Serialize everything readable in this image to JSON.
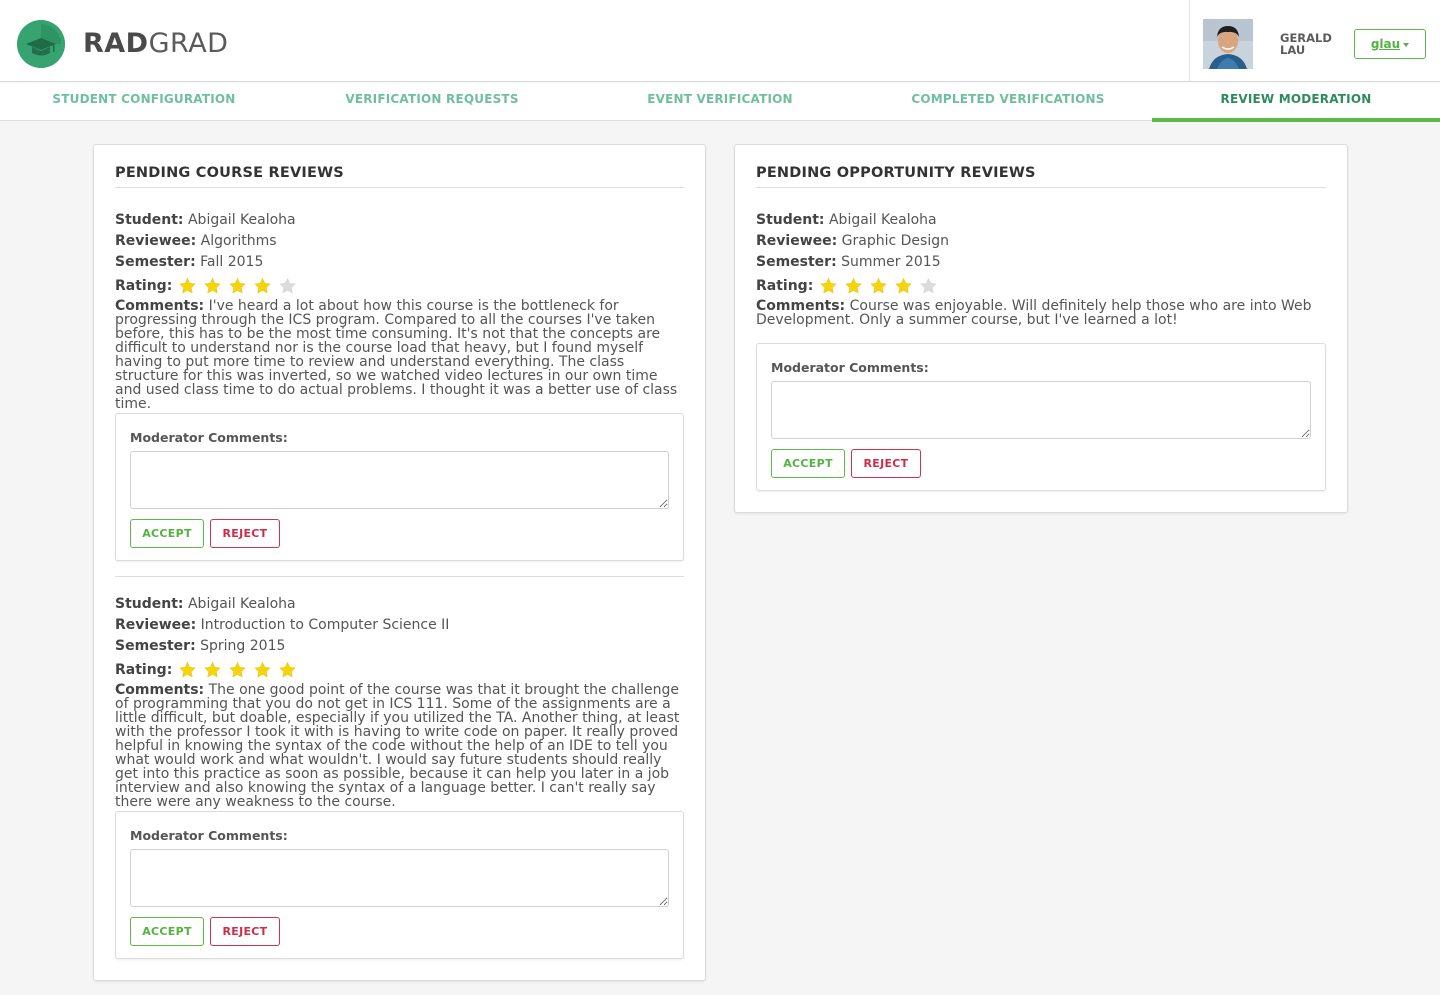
{
  "brand": {
    "rad": "RAD",
    "grad": "GRAD"
  },
  "user": {
    "first_name": "GERALD",
    "last_name": "LAU",
    "username": "glau"
  },
  "nav": {
    "items": [
      {
        "label": "STUDENT CONFIGURATION"
      },
      {
        "label": "VERIFICATION REQUESTS"
      },
      {
        "label": "EVENT VERIFICATION"
      },
      {
        "label": "COMPLETED VERIFICATIONS"
      },
      {
        "label": "REVIEW MODERATION"
      }
    ],
    "active": "REVIEW MODERATION"
  },
  "labels": {
    "student": "Student:",
    "reviewee": "Reviewee:",
    "semester": "Semester:",
    "rating": "Rating:",
    "comments": "Comments:",
    "moderator_comments": "Moderator Comments:",
    "accept": "ACCEPT",
    "reject": "REJECT"
  },
  "course_reviews": {
    "title": "PENDING COURSE REVIEWS",
    "items": [
      {
        "student": "Abigail Kealoha",
        "reviewee": "Algorithms",
        "semester": "Fall 2015",
        "rating": 4,
        "comments": "I've heard a lot about how this course is the bottleneck for progressing through the ICS program. Compared to all the courses I've taken before, this has to be the most time consuming. It's not that the concepts are difficult to understand nor is the course load that heavy, but I found myself having to put more time to review and understand everything. The class structure for this was inverted, so we watched video lectures in our own time and used class time to do actual problems. I thought it was a better use of class time."
      },
      {
        "student": "Abigail Kealoha",
        "reviewee": "Introduction to Computer Science II",
        "semester": "Spring 2015",
        "rating": 5,
        "comments": "The one good point of the course was that it brought the challenge of programming that you do not get in ICS 111. Some of the assignments are a little difficult, but doable, especially if you utilized the TA. Another thing, at least with the professor I took it with is having to write code on paper. It really proved helpful in knowing the syntax of the code without the help of an IDE to tell you what would work and what wouldn't. I would say future students should really get into this practice as soon as possible, because it can help you later in a job interview and also knowing the syntax of a language better. I can't really say there were any weakness to the course."
      }
    ]
  },
  "opportunity_reviews": {
    "title": "PENDING OPPORTUNITY REVIEWS",
    "items": [
      {
        "student": "Abigail Kealoha",
        "reviewee": "Graphic Design",
        "semester": "Summer 2015",
        "rating": 4,
        "comments": "Course was enjoyable. Will definitely help those who are into Web Development. Only a summer course, but I've learned a lot!"
      }
    ]
  },
  "colors": {
    "accent_green": "#5bbb45",
    "nav_text": "#6fbf9e",
    "nav_active": "#2e8b5e",
    "reject_red": "#cc2d47",
    "star_on": "#f5d50a",
    "star_off": "#dcdcdc"
  }
}
